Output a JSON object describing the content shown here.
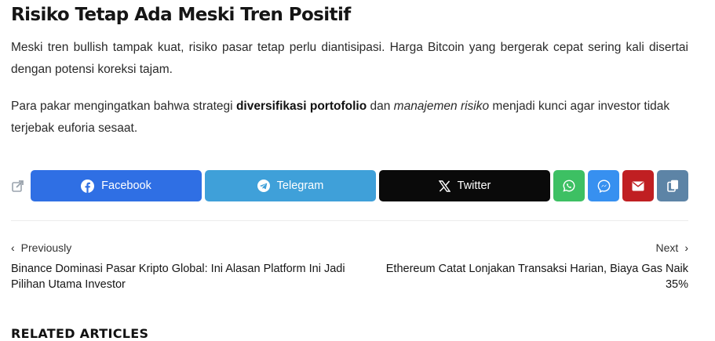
{
  "article": {
    "heading": "Risiko Tetap Ada Meski Tren Positif",
    "para1": "Meski tren bullish tampak kuat, risiko pasar tetap perlu diantisipasi. Harga Bitcoin yang bergerak cepat sering kali disertai dengan potensi koreksi tajam.",
    "para2_start": "Para pakar mengingatkan bahwa strategi ",
    "para2_bold": "diversifikasi portofolio",
    "para2_mid": " dan ",
    "para2_italic": "manajemen risiko",
    "para2_end": " menjadi kunci agar investor tidak terjebak euforia sesaat."
  },
  "share": {
    "icon": "share-icon",
    "buttons": [
      {
        "label": "Facebook",
        "icon": "facebook-icon",
        "color": "#2f6fe4"
      },
      {
        "label": "Telegram",
        "icon": "telegram-icon",
        "color": "#3fa0d9"
      },
      {
        "label": "Twitter",
        "icon": "x-icon",
        "color": "#0a0a0a"
      },
      {
        "label": "",
        "icon": "whatsapp-icon",
        "color": "#3dc063"
      },
      {
        "label": "",
        "icon": "messenger-icon",
        "color": "#3790f0"
      },
      {
        "label": "",
        "icon": "email-icon",
        "color": "#c01f22"
      },
      {
        "label": "",
        "icon": "copy-icon",
        "color": "#5d84a6"
      }
    ]
  },
  "post_nav": {
    "prev_label": "Previously",
    "prev_title": "Binance Dominasi Pasar Kripto Global: Ini Alasan Platform Ini Jadi Pilihan Utama Investor",
    "next_label": "Next",
    "next_title": "Ethereum Catat Lonjakan Transaksi Harian, Biaya Gas Naik 35%"
  },
  "related_heading": "RELATED ARTICLES"
}
